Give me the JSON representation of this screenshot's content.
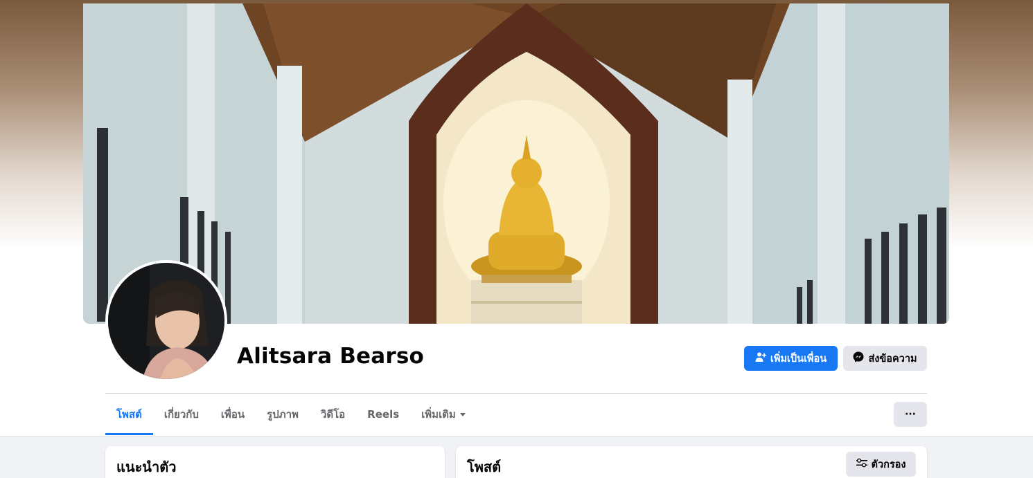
{
  "profile": {
    "name": "Alitsara Bearso"
  },
  "actions": {
    "add_friend": "เพิ่มเป็นเพื่อน",
    "message": "ส่งข้อความ",
    "more": "···"
  },
  "tabs": [
    {
      "label": "โพสต์",
      "active": true
    },
    {
      "label": "เกี่ยวกับ",
      "active": false
    },
    {
      "label": "เพื่อน",
      "active": false
    },
    {
      "label": "รูปภาพ",
      "active": false
    },
    {
      "label": "วิดีโอ",
      "active": false
    },
    {
      "label": "Reels",
      "active": false
    },
    {
      "label": "เพิ่มเติม",
      "active": false
    }
  ],
  "intro": {
    "title": "แนะนำตัว"
  },
  "posts": {
    "title": "โพสต์",
    "filter": "ตัวกรอง"
  },
  "colors": {
    "accent": "#1877f2",
    "secondary_button": "#e4e6eb",
    "page_bg": "#f0f2f5"
  },
  "icons": {
    "add_friend": "person-plus-icon",
    "message": "messenger-icon",
    "filter": "sliders-icon",
    "dropdown": "caret-down-icon"
  }
}
